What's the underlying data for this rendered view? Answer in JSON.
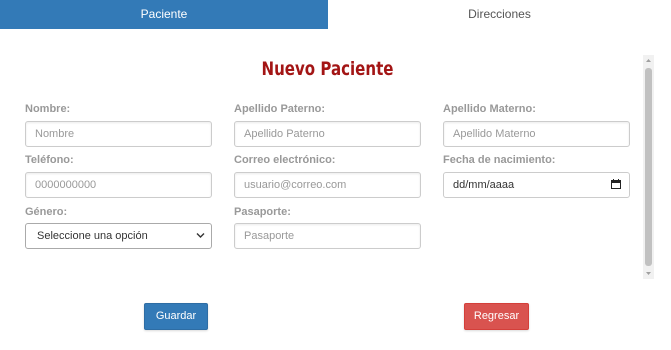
{
  "tabs": [
    {
      "label": "Paciente",
      "active": true
    },
    {
      "label": "Direcciones",
      "active": false
    }
  ],
  "form": {
    "title": "Nuevo Paciente",
    "nombre": {
      "label": "Nombre:",
      "placeholder": "Nombre",
      "value": ""
    },
    "apellido_paterno": {
      "label": "Apellido Paterno:",
      "placeholder": "Apellido Paterno",
      "value": ""
    },
    "apellido_materno": {
      "label": "Apellido Materno:",
      "placeholder": "Apellido Materno",
      "value": ""
    },
    "telefono": {
      "label": "Teléfono:",
      "placeholder": "0000000000",
      "value": ""
    },
    "correo": {
      "label": "Correo electrónico:",
      "placeholder": "usuario@correo.com",
      "value": ""
    },
    "fecha_nacimiento": {
      "label": "Fecha de nacimiento:",
      "display": "dd/mm/aaaa"
    },
    "genero": {
      "label": "Género:",
      "selected": "Seleccione una opción"
    },
    "pasaporte": {
      "label": "Pasaporte:",
      "placeholder": "Pasaporte",
      "value": ""
    }
  },
  "actions": {
    "save_label": "Guardar",
    "back_label": "Regresar"
  },
  "colors": {
    "primary": "#337ab7",
    "danger": "#d9534f",
    "title": "#a31515"
  },
  "icons": {
    "date_picker": "calendar-icon",
    "select": "chevron-down-icon",
    "scroll_up": "scroll-up-arrow-icon",
    "scroll_down": "scroll-down-arrow-icon"
  }
}
